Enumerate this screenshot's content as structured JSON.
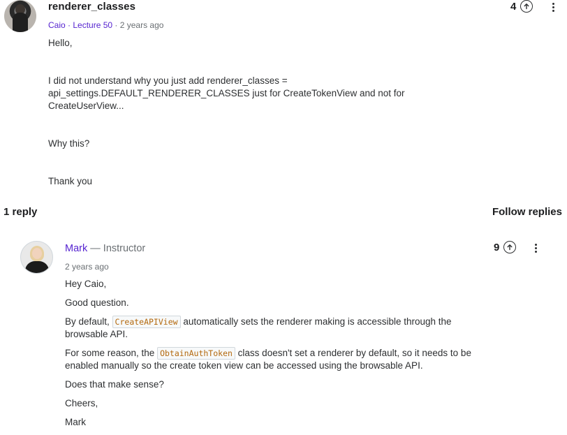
{
  "question": {
    "title": "renderer_classes",
    "author": "Caio",
    "lecture": "Lecture 50",
    "time": "2 years ago",
    "separator": " · ",
    "paragraphs": [
      "Hello,",
      "",
      "I did not understand why you just add renderer_classes = api_settings.DEFAULT_RENDERER_CLASSES just for CreateTokenView and not for CreateUserView...",
      "",
      "Why this?",
      "",
      "Thank you"
    ],
    "upvotes": "4",
    "upvote_icon": "arrow-up-circle-icon",
    "menu_icon": "more-vertical-icon"
  },
  "replies_header": {
    "count_label": "1 reply",
    "follow_label": "Follow replies"
  },
  "reply": {
    "author": "Mark",
    "role_separator": " — ",
    "role": "Instructor",
    "time": "2 years ago",
    "upvotes": "9",
    "greeting": "Hey Caio,",
    "p1": "Good question.",
    "p2_before": "By default, ",
    "p2_code": "CreateAPIView",
    "p2_after": " automatically sets the renderer making is accessible through the browsable API.",
    "p3_before": "For some reason, the ",
    "p3_code": "ObtainAuthToken",
    "p3_after": " class doesn't set a renderer by default, so it needs to be enabled manually so the create token view can be accessed using the browsable API.",
    "p4": "Does that make sense?",
    "p5": "Cheers,",
    "signature": "Mark"
  },
  "colors": {
    "link": "#5624d0",
    "code": "#b4690e",
    "text": "#2d2f31",
    "muted": "#6a6f73"
  }
}
